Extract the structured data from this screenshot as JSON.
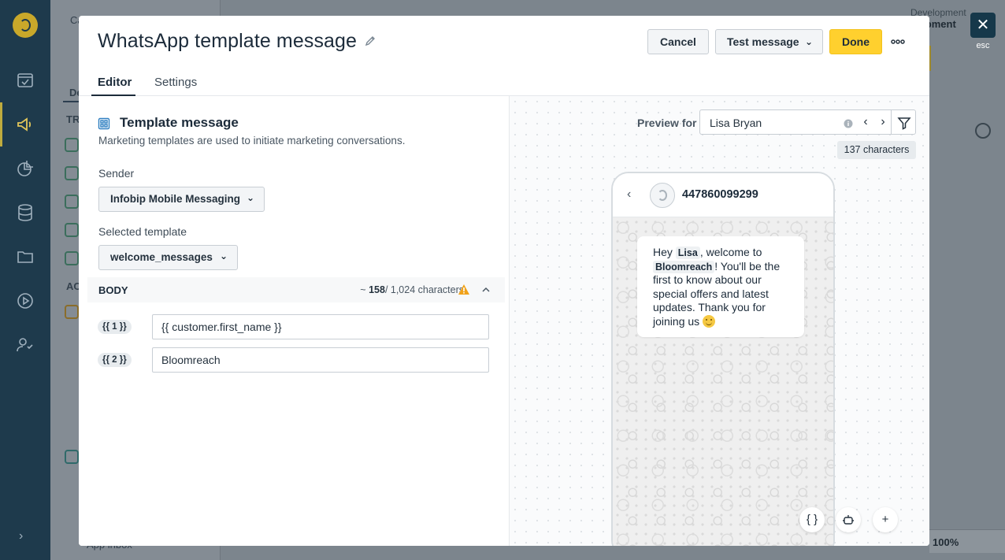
{
  "background": {
    "sidebar_section_1": "TR",
    "sidebar_section_2": "AC",
    "tab_short": "De",
    "top_left_text": "Ca",
    "env_label": "Development",
    "env_value": "elopment",
    "bottom_item": "App inbox",
    "zoom_level": "100%"
  },
  "close": {
    "label": "esc"
  },
  "modal": {
    "title": "WhatsApp template message",
    "buttons": {
      "cancel": "Cancel",
      "test": "Test message",
      "done": "Done"
    },
    "tabs": [
      {
        "label": "Editor",
        "active": true
      },
      {
        "label": "Settings",
        "active": false
      }
    ]
  },
  "editor": {
    "section_title": "Template message",
    "section_desc": "Marketing templates are used to initiate marketing conversations.",
    "sender_label": "Sender",
    "sender_value": "Infobip Mobile Messaging",
    "template_label": "Selected template",
    "template_value": "welcome_messages",
    "body": {
      "label": "BODY",
      "count_prefix": "~ ",
      "count_value": "158",
      "count_suffix": "/ 1,024 characters"
    },
    "variables": [
      {
        "chip": "{{ 1 }}",
        "value": "{{ customer.first_name }}"
      },
      {
        "chip": "{{ 2 }}",
        "value": "Bloomreach"
      }
    ]
  },
  "preview": {
    "label": "Preview for",
    "customer": "Lisa Bryan",
    "char_count": "137 characters",
    "contact_number": "447860099299",
    "message": {
      "part1": "Hey ",
      "name": "Lisa",
      "part2": ", welcome to ",
      "brand": "Bloomreach",
      "part3": "! You'll be the first to know about our special offers and latest updates. Thank you for joining us "
    },
    "actions": {
      "code": "{ }",
      "add": "+"
    }
  },
  "colors": {
    "accent_yellow": "#ffd02e",
    "navy": "#1e3a4c",
    "text_dark": "#1c2b3a",
    "warning": "#f0a21a"
  }
}
